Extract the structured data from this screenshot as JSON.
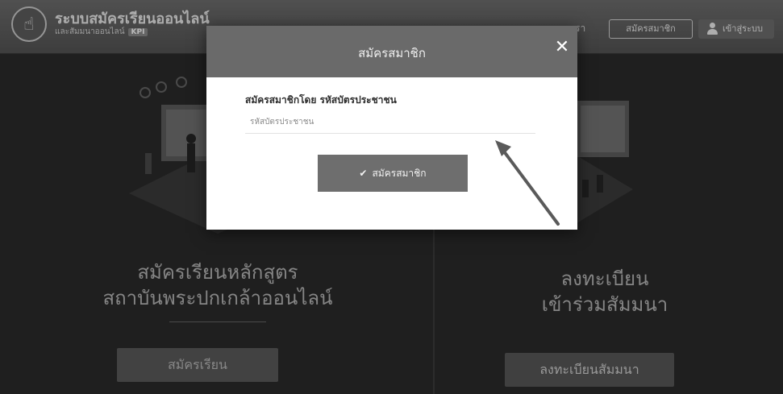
{
  "header": {
    "logo_icon": "hand-pointer-icon",
    "title": "ระบบสมัครเรียนออนไลน์",
    "subtitle": "และสัมมนาออนไลน์",
    "subtitle_tag": "KPI",
    "nav_link": "รา",
    "register_button": "สมัครสมาชิก",
    "login_button": "เข้าสู่ระบบ",
    "login_icon": "user-icon"
  },
  "hero": {
    "left_title_line1": "สมัครเรียนหลักสูตร",
    "left_title_line2": "สถาบันพระปกเกล้าออนไลน์",
    "left_button": "สมัครเรียน",
    "right_title_line1": "ลงทะเบียน",
    "right_title_line2": "เข้าร่วมสัมมนา",
    "right_button": "ลงทะเบียนสัมมนา"
  },
  "modal": {
    "title": "สมัครสมาชิก",
    "close_icon": "close-icon",
    "label": "สมัครสมาชิกโดย รหัสบัตรประชาชน",
    "input_placeholder": "รหัสบัตรประชาชน",
    "input_value": "",
    "submit_icon": "check-icon",
    "submit_label": "สมัครสมาชิก"
  },
  "colors": {
    "header_bg": "#5e5e5e",
    "modal_header_bg": "#6a6a6a",
    "submit_bg": "#6e6e6e"
  }
}
